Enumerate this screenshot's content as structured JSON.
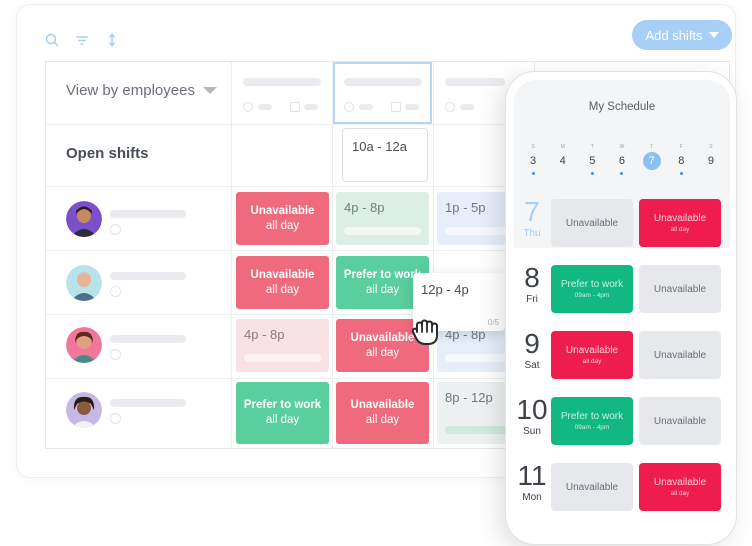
{
  "toolbar": {
    "add_shifts_label": "Add shifts"
  },
  "grid": {
    "view_by_label": "View by employees",
    "open_shifts_label": "Open shifts",
    "open_shift_time": "10a - 12a",
    "rows": [
      {
        "cells": [
          {
            "type": "red",
            "title": "Unavailable",
            "sub": "all day"
          },
          {
            "type": "pale-green",
            "title": "4p - 8p"
          },
          {
            "type": "pale-blue",
            "title": "1p - 5p"
          }
        ]
      },
      {
        "cells": [
          {
            "type": "red",
            "title": "Unavailable",
            "sub": "all day"
          },
          {
            "type": "green",
            "title": "Prefer to work",
            "sub": "all day"
          }
        ]
      },
      {
        "cells": [
          {
            "type": "pale-red",
            "title": "4p - 8p"
          },
          {
            "type": "red",
            "title": "Unavailable",
            "sub": "all day"
          },
          {
            "type": "pale-blue",
            "title": "4p - 8p"
          }
        ]
      },
      {
        "cells": [
          {
            "type": "green",
            "title": "Prefer to work",
            "sub": "all day"
          },
          {
            "type": "red",
            "title": "Unavailable",
            "sub": "all day"
          },
          {
            "type": "pale-gray",
            "title": "8p - 12p"
          }
        ]
      }
    ],
    "drag_card": {
      "time": "12p - 4p",
      "count": "0/5"
    }
  },
  "phone": {
    "title": "My Schedule",
    "week": [
      {
        "letter": "S",
        "num": "3",
        "dot": true
      },
      {
        "letter": "M",
        "num": "4",
        "dot": false
      },
      {
        "letter": "T",
        "num": "5",
        "dot": true
      },
      {
        "letter": "W",
        "num": "6",
        "dot": true
      },
      {
        "letter": "T",
        "num": "7",
        "dot": false,
        "active": true
      },
      {
        "letter": "F",
        "num": "8",
        "dot": true
      },
      {
        "letter": "S",
        "num": "9",
        "dot": false
      }
    ],
    "schedule": [
      {
        "num": "7",
        "day": "Thu",
        "today": true,
        "left": {
          "type": "gray",
          "title": "Unavailable"
        },
        "right": {
          "type": "red",
          "title": "Unavailable",
          "sub": "all day"
        }
      },
      {
        "num": "8",
        "day": "Fri",
        "left": {
          "type": "green",
          "title": "Prefer to work",
          "sub": "09am - 4pm"
        },
        "right": {
          "type": "gray",
          "title": "Unavailable"
        }
      },
      {
        "num": "9",
        "day": "Sat",
        "left": {
          "type": "red",
          "title": "Unavailable",
          "sub": "all day"
        },
        "right": {
          "type": "gray",
          "title": "Unavailable"
        }
      },
      {
        "num": "10",
        "day": "Sun",
        "left": {
          "type": "green",
          "title": "Prefer to work",
          "sub": "09am - 4pm"
        },
        "right": {
          "type": "gray",
          "title": "Unavailable"
        }
      },
      {
        "num": "11",
        "day": "Mon",
        "left": {
          "type": "gray",
          "title": "Unavailable"
        },
        "right": {
          "type": "red",
          "title": "Unavailable",
          "sub": "all day"
        }
      }
    ]
  },
  "colors": {
    "unavailable_red": "#f06a7d",
    "prefer_green": "#58cf9c",
    "phone_red": "#ee1d4d",
    "phone_green": "#12b882",
    "accent_blue": "#a8cff8"
  }
}
